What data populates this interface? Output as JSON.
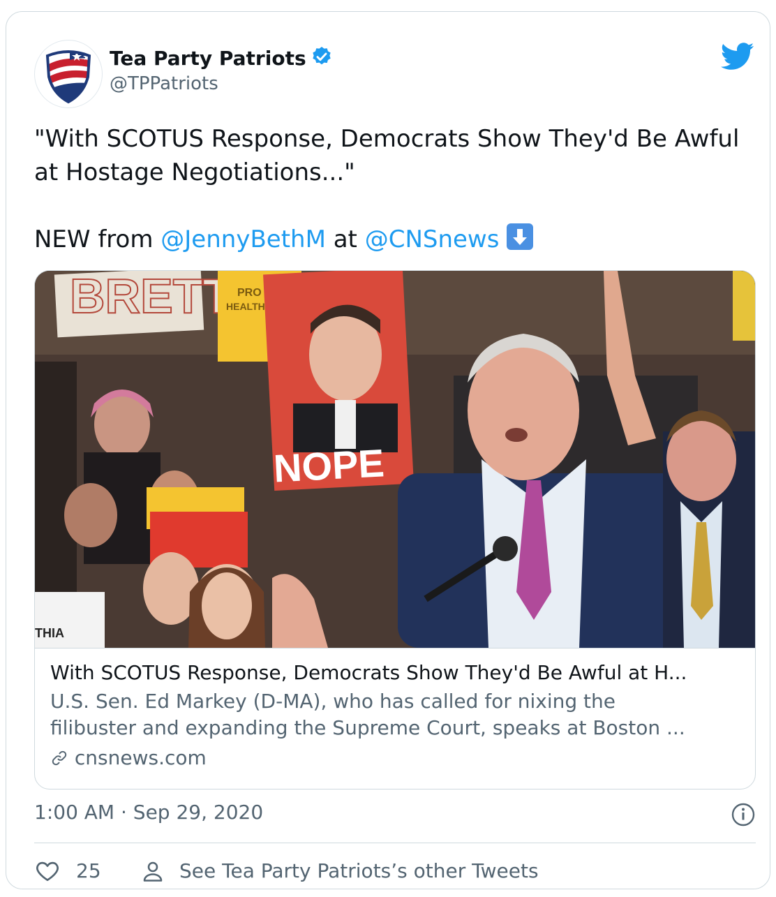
{
  "author": {
    "name": "Tea Party Patriots",
    "handle": "@TPPatriots",
    "avatar_icon": "shield-flag-icon",
    "verified": true
  },
  "tweet": {
    "line1": "\"With SCOTUS Response, Democrats Show They'd Be Awful at Hostage Negotiations...\"",
    "new_from": "NEW from",
    "mention1": "@JennyBethM",
    "at": "at",
    "mention2": "@CNSnews",
    "emoji": "down-arrow-emoji"
  },
  "link_card": {
    "image_alt": "photo",
    "sign_nope": "NOPE",
    "title": "With SCOTUS Response, Democrats Show They'd Be Awful at H...",
    "description_line1": "U.S. Sen. Ed Markey (D-MA), who has called for nixing the",
    "description_line2": "filibuster and expanding the Supreme Court, speaks at Boston ...",
    "domain": "cnsnews.com"
  },
  "meta": {
    "timestamp": "1:00 AM · Sep 29, 2020"
  },
  "actions": {
    "likes": "25",
    "other_tweets": "See Tea Party Patriots’s other Tweets"
  },
  "colors": {
    "accent": "#1d9bf0",
    "text": "#0f1419",
    "muted": "#536471",
    "border": "#cfd9de"
  }
}
